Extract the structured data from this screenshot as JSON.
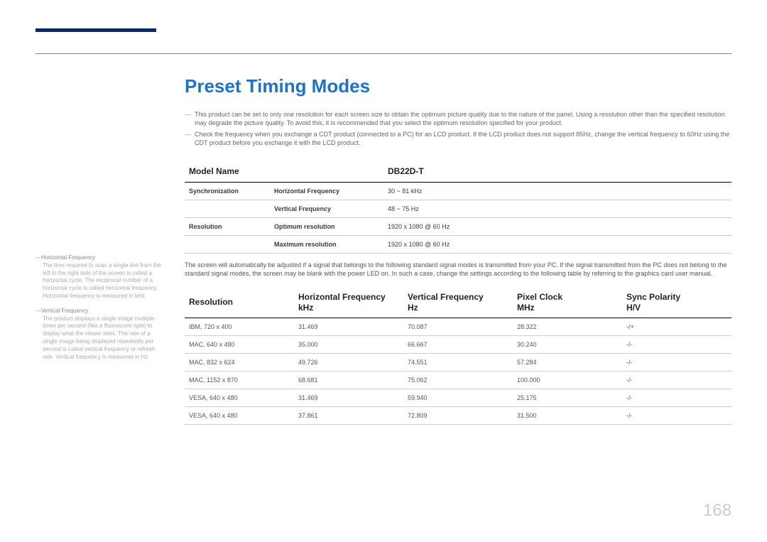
{
  "title": "Preset Timing Modes",
  "bullets": [
    "This product can be set to only one resolution for each screen size to obtain the optimum picture quality due to the nature of the panel. Using a resolution other than the specified resolution may degrade the picture quality. To avoid this, it is recommended that you select the optimum resolution specified for your product.",
    "Check the frequency when you exchange a CDT product (connected to a PC) for an LCD product. If the LCD product does not support 85Hz, change the vertical frequency to 60Hz using the CDT product before you exchange it with the LCD product."
  ],
  "spec": {
    "header": {
      "left": "Model Name",
      "right": "DB22D-T"
    },
    "rows": [
      {
        "group": "Synchronization",
        "label": "Horizontal Frequency",
        "value": "30 ~ 81 kHz"
      },
      {
        "group": "",
        "label": "Vertical Frequency",
        "value": "48 ~ 75 Hz"
      },
      {
        "group": "Resolution",
        "label": "Optimum resolution",
        "value": "1920 x 1080 @ 60 Hz"
      },
      {
        "group": "",
        "label": "Maximum resolution",
        "value": "1920 x 1080 @ 60 Hz"
      }
    ]
  },
  "mid_text": "The screen will automatically be adjusted if a signal that belongs to the following standard signal modes is transmitted from your PC. If the signal transmitted from the PC does not belong to the standard signal modes, the screen may be blank with the power LED on. In such a case, change the settings according to the following table by referring to the graphics card user manual.",
  "timing": {
    "headers": [
      "Resolution",
      "Horizontal Frequency\nkHz",
      "Vertical Frequency\nHz",
      "Pixel Clock\nMHz",
      "Sync Polarity\nH/V"
    ],
    "rows": [
      [
        "IBM, 720 x 400",
        "31.469",
        "70.087",
        "28.322",
        "-/+"
      ],
      [
        "MAC, 640 x 480",
        "35.000",
        "66.667",
        "30.240",
        "-/-"
      ],
      [
        "MAC, 832 x 624",
        "49.726",
        "74.551",
        "57.284",
        "-/-"
      ],
      [
        "MAC, 1152 x 870",
        "68.681",
        "75.062",
        "100.000",
        "-/-"
      ],
      [
        "VESA, 640 x 480",
        "31.469",
        "59.940",
        "25.175",
        "-/-"
      ],
      [
        "VESA, 640 x 480",
        "37.861",
        "72.809",
        "31.500",
        "-/-"
      ]
    ]
  },
  "sidebar": [
    {
      "head": "Horizontal Frequency",
      "body": "The time required to scan a single line from the left to the right side of the screen is called a horizontal cycle. The reciprocal number of a horizontal cycle is called horizontal frequency. Horizontal frequency is measured in kHz."
    },
    {
      "head": "Vertical Frequency",
      "body": "The product displays a single image multiple times per second (like a fluorescent light) to display what the viewer sees. The rate of a single image being displayed repeatedly per second is called vertical frequency or refresh rate. Vertical frequency is measured in Hz."
    }
  ],
  "page_number": "168",
  "chart_data": {
    "type": "table",
    "title": "Preset Timing Modes",
    "columns": [
      "Resolution",
      "Horizontal Frequency (kHz)",
      "Vertical Frequency (Hz)",
      "Pixel Clock (MHz)",
      "Sync Polarity H/V"
    ],
    "rows": [
      [
        "IBM, 720 x 400",
        31.469,
        70.087,
        28.322,
        "-/+"
      ],
      [
        "MAC, 640 x 480",
        35.0,
        66.667,
        30.24,
        "-/-"
      ],
      [
        "MAC, 832 x 624",
        49.726,
        74.551,
        57.284,
        "-/-"
      ],
      [
        "MAC, 1152 x 870",
        68.681,
        75.062,
        100.0,
        "-/-"
      ],
      [
        "VESA, 640 x 480",
        31.469,
        59.94,
        25.175,
        "-/-"
      ],
      [
        "VESA, 640 x 480",
        37.861,
        72.809,
        31.5,
        "-/-"
      ]
    ]
  }
}
